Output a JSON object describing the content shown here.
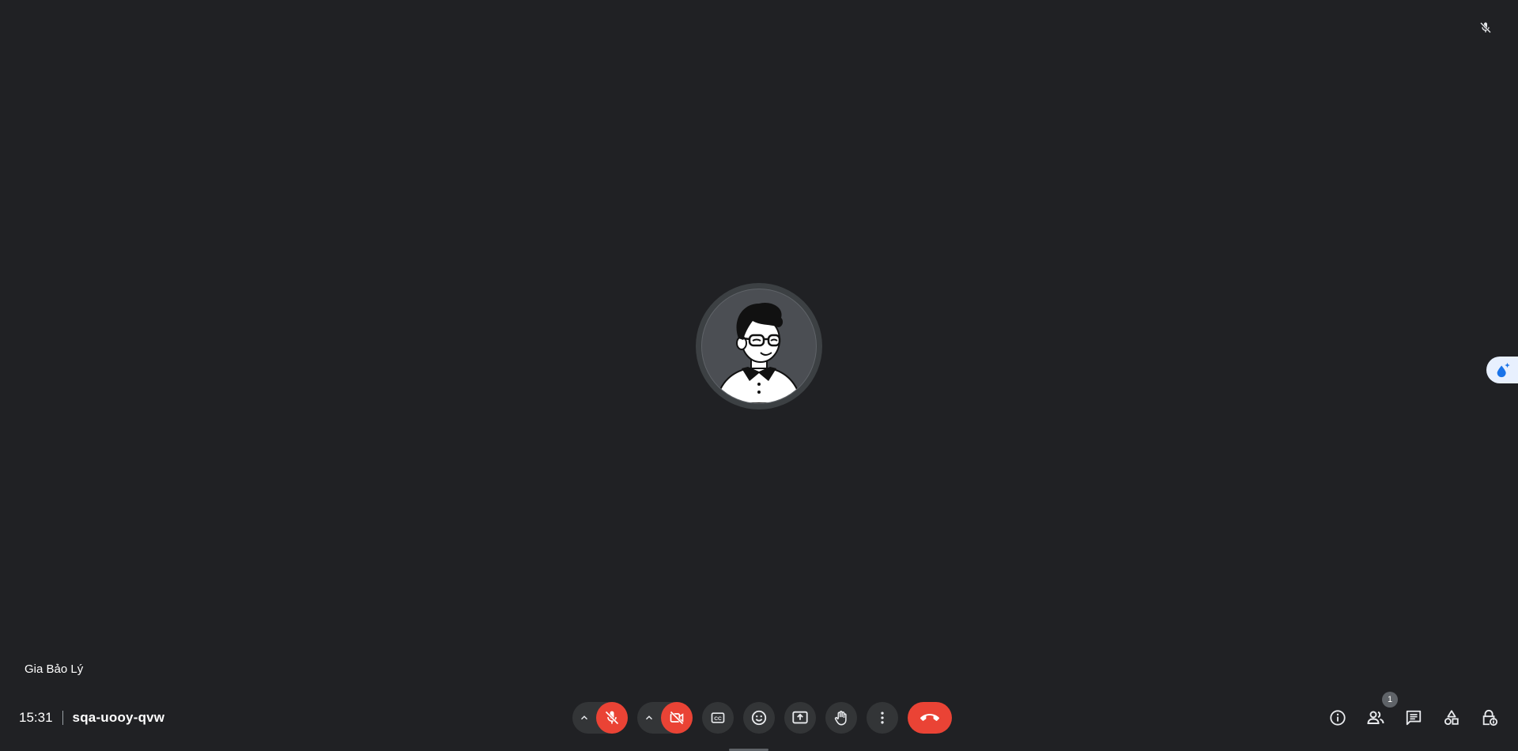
{
  "participant": {
    "name": "Gia Bảo Lý"
  },
  "meeting": {
    "time": "15:31",
    "code": "sqa-uooy-qvw"
  },
  "participants_count": "1",
  "icons": {
    "mic_status": "mic-off-icon",
    "avatar": "avatar-illustration",
    "effects": "visual-effects-icon",
    "mic": "mic-off-icon",
    "camera": "videocam-off-icon",
    "captions": "closed-captions-icon",
    "emoji": "emoji-reaction-icon",
    "present": "present-screen-icon",
    "raise_hand": "raise-hand-icon",
    "more": "more-options-icon",
    "leave": "call-end-icon",
    "info": "info-icon",
    "people": "people-icon",
    "chat": "chat-icon",
    "activities": "activities-icon",
    "host_controls": "host-controls-icon"
  },
  "colors": {
    "background": "#202124",
    "danger": "#ea4335",
    "button": "#333537"
  }
}
